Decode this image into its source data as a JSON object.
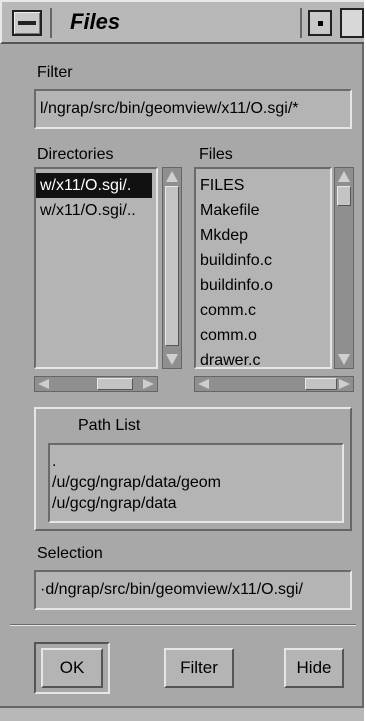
{
  "window": {
    "title": "Files"
  },
  "filter": {
    "label": "Filter",
    "value": "l/ngrap/src/bin/geomview/x11/O.sgi/*"
  },
  "directories": {
    "label": "Directories",
    "items": [
      {
        "text": "w/x11/O.sgi/.",
        "selected": true
      },
      {
        "text": "w/x11/O.sgi/..",
        "selected": false
      }
    ]
  },
  "files": {
    "label": "Files",
    "items": [
      "FILES",
      "Makefile",
      "Mkdep",
      "buildinfo.c",
      "buildinfo.o",
      "comm.c",
      "comm.o",
      "drawer.c"
    ]
  },
  "path_list": {
    "label": "Path List",
    "items": [
      ".",
      "/u/gcg/ngrap/data/geom",
      "/u/gcg/ngrap/data"
    ]
  },
  "selection": {
    "label": "Selection",
    "value": "·d/ngrap/src/bin/geomview/x11/O.sgi/"
  },
  "buttons": {
    "ok": "OK",
    "filter": "Filter",
    "hide": "Hide"
  }
}
